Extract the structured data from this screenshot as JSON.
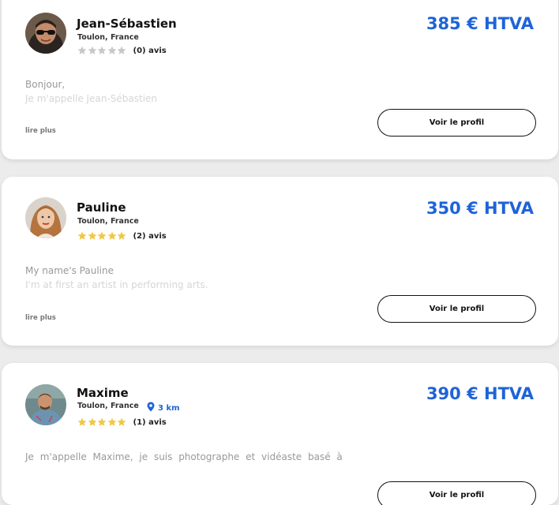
{
  "profiles": [
    {
      "name": "Jean-Sébastien",
      "location": "Toulon, France",
      "rating": 0,
      "reviews": "(0) avis",
      "price": "385 € HTVA",
      "bio_line1": "Bonjour,",
      "bio_line2": "Je m'appelle Jean-Sébastien",
      "read_more": "lire plus",
      "button": "Voir le profil"
    },
    {
      "name": "Pauline",
      "location": "Toulon, France",
      "rating": 5,
      "reviews": "(2) avis",
      "price": "350 € HTVA",
      "bio_line1": "My name's Pauline",
      "bio_line2": "I'm at first an artist in performing arts.",
      "read_more": "lire plus",
      "button": "Voir le profil"
    },
    {
      "name": "Maxime",
      "location": "Toulon, France",
      "distance": "3 km",
      "rating": 5,
      "reviews": "(1) avis",
      "price": "390 € HTVA",
      "bio_line1": "Je m'appelle Maxime, je suis photographe et vidéaste basé à",
      "button": "Voir le profil"
    }
  ],
  "colors": {
    "accent": "#1e63d8",
    "star_filled": "#f2c744",
    "star_empty": "#c8c8c8",
    "background": "#ececec"
  },
  "icons": {
    "star": "star-icon",
    "location": "map-pin-icon"
  }
}
